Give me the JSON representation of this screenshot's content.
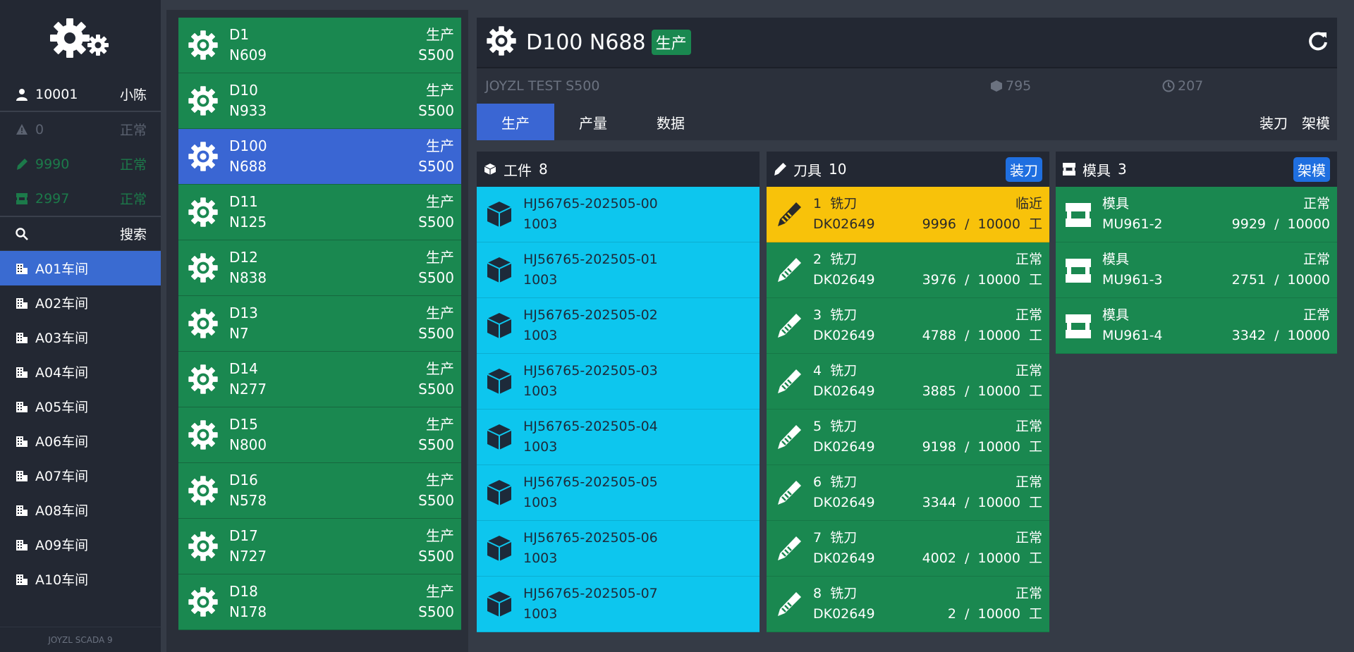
{
  "sidebar": {
    "user": {
      "id": "10001",
      "name": "小陈"
    },
    "stats": [
      {
        "icon": "warning-icon",
        "value": "0",
        "status": "正常"
      },
      {
        "icon": "tool-icon",
        "value": "9990",
        "status": "正常"
      },
      {
        "icon": "mold-icon",
        "value": "2997",
        "status": "正常"
      }
    ],
    "search_label": "搜索",
    "workshops": [
      "A01车间",
      "A02车间",
      "A03车间",
      "A04车间",
      "A05车间",
      "A06车间",
      "A07车间",
      "A08车间",
      "A09车间",
      "A10车间"
    ],
    "footer": "JOYZL SCADA 9"
  },
  "machines": [
    {
      "id": "D1",
      "code": "N609",
      "status": "生产",
      "model": "S500"
    },
    {
      "id": "D10",
      "code": "N933",
      "status": "生产",
      "model": "S500"
    },
    {
      "id": "D100",
      "code": "N688",
      "status": "生产",
      "model": "S500"
    },
    {
      "id": "D11",
      "code": "N125",
      "status": "生产",
      "model": "S500"
    },
    {
      "id": "D12",
      "code": "N838",
      "status": "生产",
      "model": "S500"
    },
    {
      "id": "D13",
      "code": "N7",
      "status": "生产",
      "model": "S500"
    },
    {
      "id": "D14",
      "code": "N277",
      "status": "生产",
      "model": "S500"
    },
    {
      "id": "D15",
      "code": "N800",
      "status": "生产",
      "model": "S500"
    },
    {
      "id": "D16",
      "code": "N578",
      "status": "生产",
      "model": "S500"
    },
    {
      "id": "D17",
      "code": "N727",
      "status": "生产",
      "model": "S500"
    },
    {
      "id": "D18",
      "code": "N178",
      "status": "生产",
      "model": "S500"
    }
  ],
  "detail": {
    "title": "D100 N688",
    "status": "生产",
    "subtitle": "JOYZL TEST S500",
    "parts_count": "795",
    "time_count": "207",
    "tabs": [
      "生产",
      "产量",
      "数据"
    ],
    "actions": [
      "装刀",
      "架模"
    ]
  },
  "workpieces": {
    "label": "工件",
    "count": "8",
    "items": [
      {
        "name": "HJ56765-202505-00",
        "qty": "1003"
      },
      {
        "name": "HJ56765-202505-01",
        "qty": "1003"
      },
      {
        "name": "HJ56765-202505-02",
        "qty": "1003"
      },
      {
        "name": "HJ56765-202505-03",
        "qty": "1003"
      },
      {
        "name": "HJ56765-202505-04",
        "qty": "1003"
      },
      {
        "name": "HJ56765-202505-05",
        "qty": "1003"
      },
      {
        "name": "HJ56765-202505-06",
        "qty": "1003"
      },
      {
        "name": "HJ56765-202505-07",
        "qty": "1003"
      }
    ]
  },
  "tools": {
    "label": "刀具",
    "count": "10",
    "button": "装刀",
    "items": [
      {
        "title": "1  铣刀",
        "code": "DK02649",
        "status": "临近",
        "usage": "9996  /  10000  工",
        "state": "warn"
      },
      {
        "title": "2  铣刀",
        "code": "DK02649",
        "status": "正常",
        "usage": "3976  /  10000  工",
        "state": "ok"
      },
      {
        "title": "3  铣刀",
        "code": "DK02649",
        "status": "正常",
        "usage": "4788  /  10000  工",
        "state": "ok"
      },
      {
        "title": "4  铣刀",
        "code": "DK02649",
        "status": "正常",
        "usage": "3885  /  10000  工",
        "state": "ok"
      },
      {
        "title": "5  铣刀",
        "code": "DK02649",
        "status": "正常",
        "usage": "9198  /  10000  工",
        "state": "ok"
      },
      {
        "title": "6  铣刀",
        "code": "DK02649",
        "status": "正常",
        "usage": "3344  /  10000  工",
        "state": "ok"
      },
      {
        "title": "7  铣刀",
        "code": "DK02649",
        "status": "正常",
        "usage": "4002  /  10000  工",
        "state": "ok"
      },
      {
        "title": "8  铣刀",
        "code": "DK02649",
        "status": "正常",
        "usage": "2  /  10000  工",
        "state": "ok"
      }
    ]
  },
  "molds": {
    "label": "模具",
    "count": "3",
    "button": "架模",
    "items": [
      {
        "title": "模具",
        "code": "MU961-2",
        "status": "正常",
        "usage": "9929  /  10000"
      },
      {
        "title": "模具",
        "code": "MU961-3",
        "status": "正常",
        "usage": "2751  /  10000"
      },
      {
        "title": "模具",
        "code": "MU961-4",
        "status": "正常",
        "usage": "3342  /  10000"
      }
    ]
  },
  "colors": {
    "production_green": "#1a8850",
    "active_blue": "#3a66d3",
    "workpiece_cyan": "#0dc6ee",
    "warning_amber": "#f8c20a",
    "button_blue": "#1f6fe0"
  }
}
